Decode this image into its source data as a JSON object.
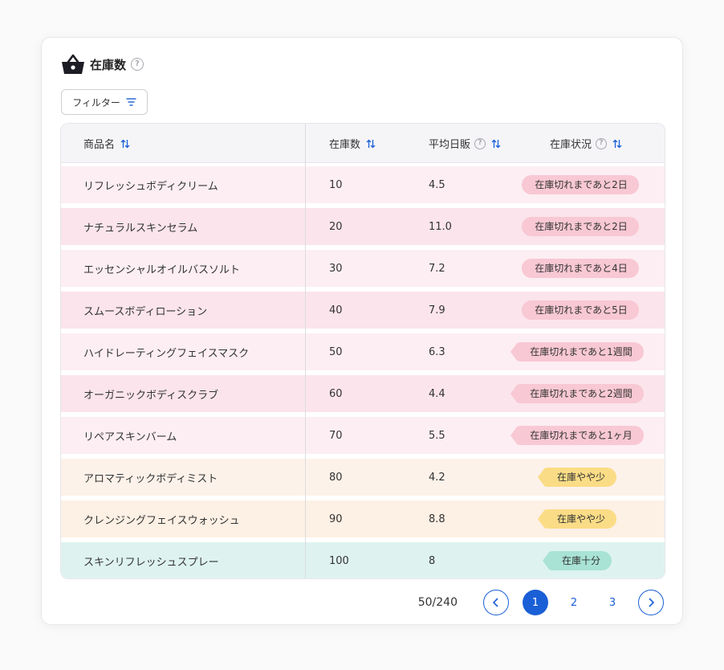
{
  "title": "在庫数",
  "title_help": "?",
  "filter_label": "フィルター",
  "columns": {
    "name": "商品名",
    "stock": "在庫数",
    "daily": "平均日販",
    "status": "在庫状況",
    "help": "?"
  },
  "rows": [
    {
      "name": "リフレッシュボディクリーム",
      "stock": "10",
      "daily": "4.5",
      "status": "在庫切れまであと2日",
      "level": "critical"
    },
    {
      "name": "ナチュラルスキンセラム",
      "stock": "20",
      "daily": "11.0",
      "status": "在庫切れまであと2日",
      "level": "critical"
    },
    {
      "name": "エッセンシャルオイルバスソルト",
      "stock": "30",
      "daily": "7.2",
      "status": "在庫切れまであと4日",
      "level": "critical"
    },
    {
      "name": "スムースボディローション",
      "stock": "40",
      "daily": "7.9",
      "status": "在庫切れまであと5日",
      "level": "critical"
    },
    {
      "name": "ハイドレーティングフェイスマスク",
      "stock": "50",
      "daily": "6.3",
      "status": "在庫切れまであと1週間",
      "level": "critical"
    },
    {
      "name": "オーガニックボディスクラブ",
      "stock": "60",
      "daily": "4.4",
      "status": "在庫切れまであと2週間",
      "level": "critical"
    },
    {
      "name": "リペアスキンバーム",
      "stock": "70",
      "daily": "5.5",
      "status": "在庫切れまであと1ヶ月",
      "level": "critical"
    },
    {
      "name": "アロマティックボディミスト",
      "stock": "80",
      "daily": "4.2",
      "status": "在庫やや少",
      "level": "low"
    },
    {
      "name": "クレンジングフェイスウォッシュ",
      "stock": "90",
      "daily": "8.8",
      "status": "在庫やや少",
      "level": "low"
    },
    {
      "name": "スキンリフレッシュスプレー",
      "stock": "100",
      "daily": "8",
      "status": "在庫十分",
      "level": "ok"
    }
  ],
  "pagination": {
    "count": "50/240",
    "pages": [
      "1",
      "2",
      "3"
    ],
    "current": "1"
  },
  "colors": {
    "accent": "#1a5fd6",
    "critical_row_a": "#fdeef3",
    "critical_row_b": "#fbe4eb",
    "critical_badge": "#f8c8d4",
    "low_row_a": "#fdf0e4",
    "low_row_b": "#fdf2ea",
    "low_badge": "#fbdc86",
    "ok_row": "#def3ef",
    "ok_badge": "#a9e3d5"
  },
  "icons": {
    "title": "basket-icon",
    "filter": "filter-lines-icon",
    "sort": "sort-arrows-icon",
    "prev": "chevron-left-icon",
    "next": "chevron-right-icon"
  }
}
